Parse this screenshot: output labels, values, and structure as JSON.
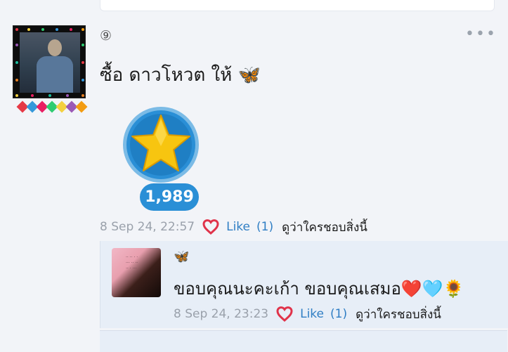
{
  "post": {
    "number_icon": "⑨",
    "menu_icon": "•••",
    "text": "ซื้อ ดาวโหวต ให้ 🦋",
    "star_count": "1,989",
    "timestamp": "8 Sep 24, 22:57",
    "like_label": "Like",
    "like_count": "(1)",
    "who_liked": "ดูว่าใครชอบสิ่งนี้"
  },
  "reply": {
    "name_emoji": "🦋",
    "text": "ขอบคุณนะคะเก้า ขอบคุณเสมอ❤️🩵🌻",
    "timestamp": "8 Sep 24, 23:23",
    "like_label": "Like",
    "like_count": "(1)",
    "who_liked": "ดูว่าใครชอบสิ่งนี้"
  },
  "colors": {
    "accent_blue": "#2a8fd6",
    "like_red": "#e0334a",
    "meta_gray": "#9aa1ab"
  }
}
